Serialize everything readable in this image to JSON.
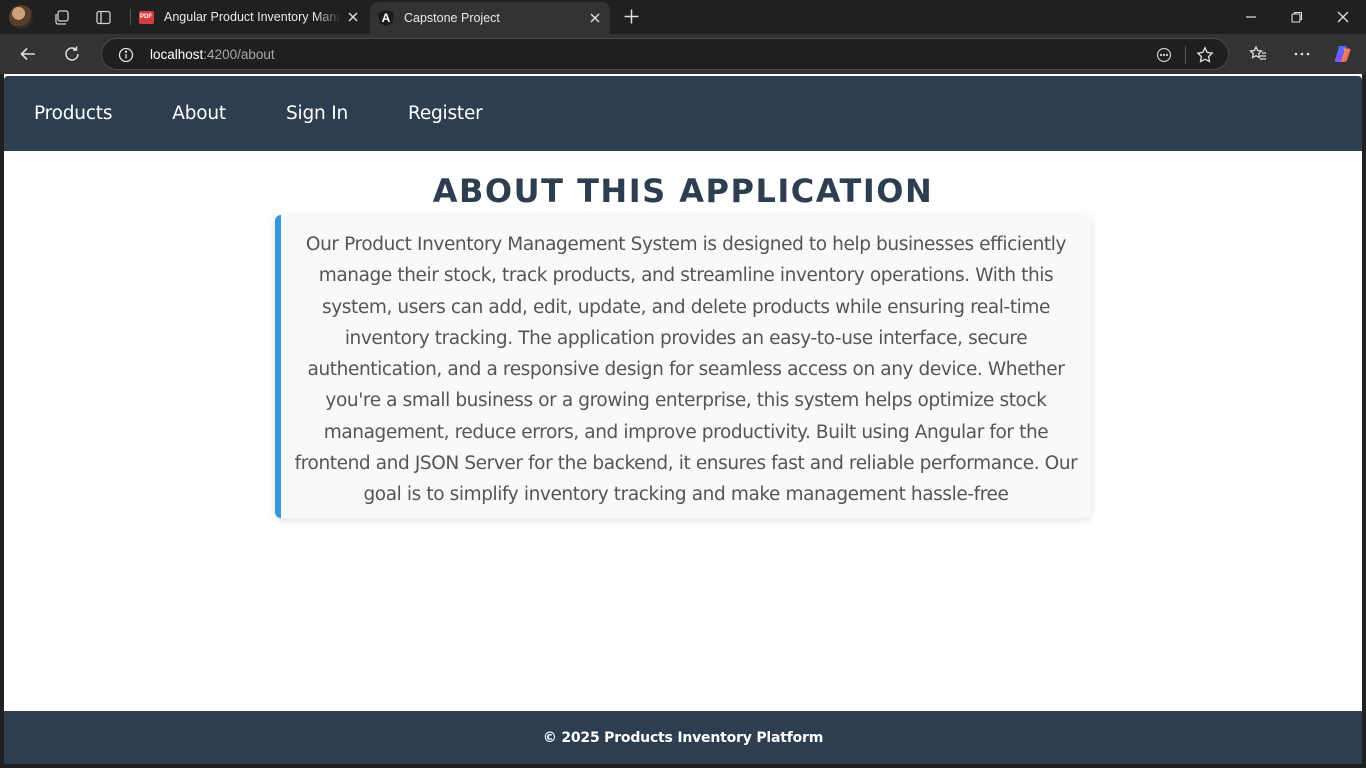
{
  "browser": {
    "tabs": [
      {
        "title": "Angular Product Inventory Management",
        "favicon": "pdf-icon",
        "favicon_text": "PDF",
        "active": false
      },
      {
        "title": "Capstone Project",
        "favicon": "angular-icon",
        "favicon_text": "A",
        "active": true
      }
    ],
    "address": {
      "host": "localhost",
      "path": ":4200/about"
    }
  },
  "nav": {
    "items": [
      {
        "label": "Products"
      },
      {
        "label": "About"
      },
      {
        "label": "Sign In"
      },
      {
        "label": "Register"
      }
    ]
  },
  "main": {
    "title": "ABOUT THIS APPLICATION",
    "body": "Our Product Inventory Management System is designed to help businesses efficiently manage their stock, track products, and streamline inventory operations. With this system, users can add, edit, update, and delete products while ensuring real-time inventory tracking. The application provides an easy-to-use interface, secure authentication, and a responsive design for seamless access on any device. Whether you're a small business or a growing enterprise, this system helps optimize stock management, reduce errors, and improve productivity. Built using Angular for the frontend and JSON Server for the backend, it ensures fast and reliable performance. Our goal is to simplify inventory tracking and make management hassle-free"
  },
  "footer": {
    "text": "© 2025 Products Inventory Platform"
  },
  "colors": {
    "navbar": "#2c3e50",
    "accent": "#3498db",
    "card_bg": "#f8f9fa",
    "body_text": "#555555"
  }
}
